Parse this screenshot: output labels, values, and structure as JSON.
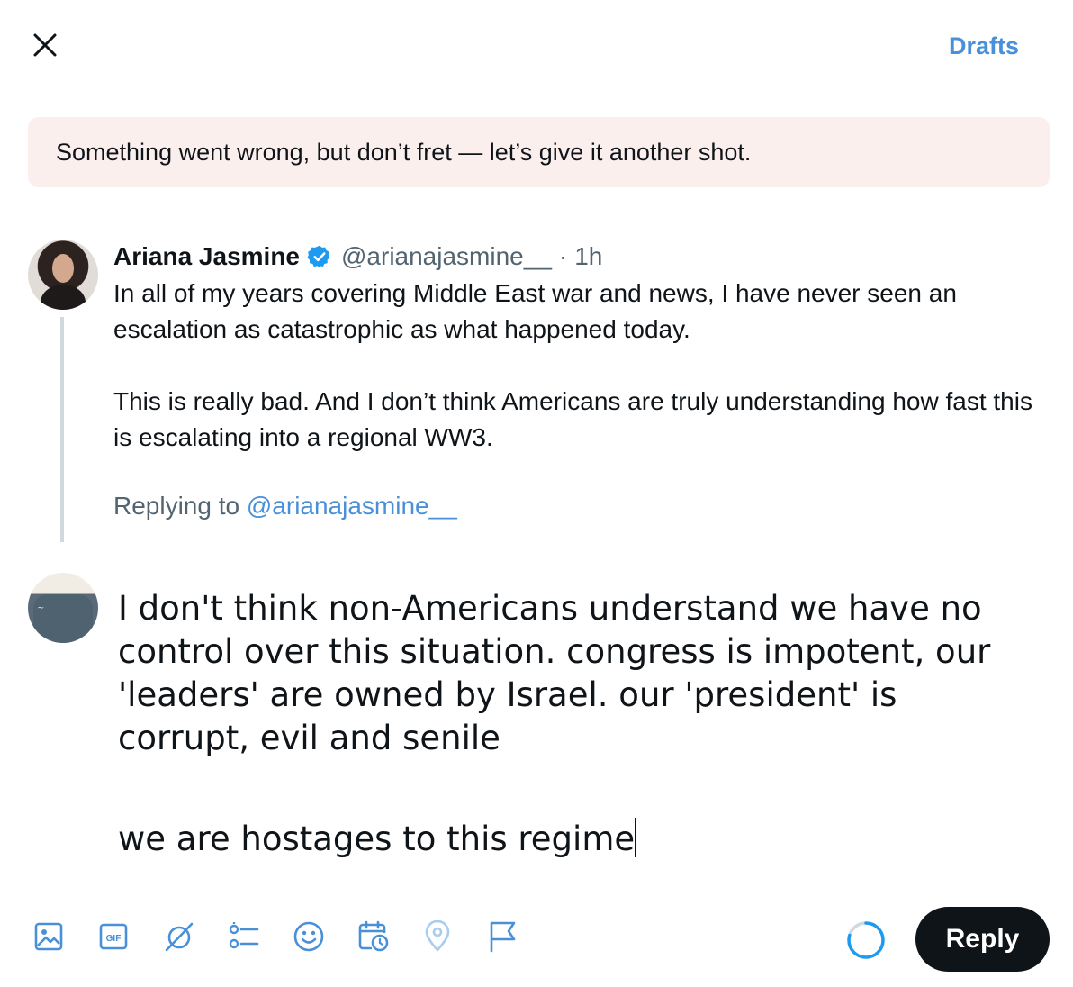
{
  "header": {
    "close_icon": "close-icon",
    "drafts_label": "Drafts",
    "accent_color": "#4a90d9"
  },
  "error_banner": {
    "message": "Something went wrong, but don’t fret — let’s give it another shot."
  },
  "original_tweet": {
    "author": "Ariana Jasmine",
    "verified_icon": "verified-badge-icon",
    "handle": "@arianajasmine__",
    "separator": "·",
    "time": "1h",
    "body": "In all of my years covering Middle East war and news, I have never seen an escalation as catastrophic as what happened today.\n\nThis is really bad. And I don’t think Americans are truly understanding how fast this is escalating into a regional WW3.",
    "replying_prefix": "Replying to",
    "replying_handle": "@arianajasmine__"
  },
  "compose": {
    "paragraph_1": "I don't think non-Americans understand we have no control over this situation.  congress is impotent, our 'leaders' are owned by Israel.  our 'president' is corrupt, evil and senile",
    "paragraph_2": "we are hostages to this regime"
  },
  "toolbar": {
    "icons": [
      "image-icon",
      "gif-icon",
      "grok-icon",
      "poll-icon",
      "emoji-icon",
      "schedule-icon",
      "location-icon",
      "flag-icon"
    ],
    "gif_text": "GIF"
  },
  "footer": {
    "reply_label": "Reply",
    "button_color": "#0f1419"
  }
}
